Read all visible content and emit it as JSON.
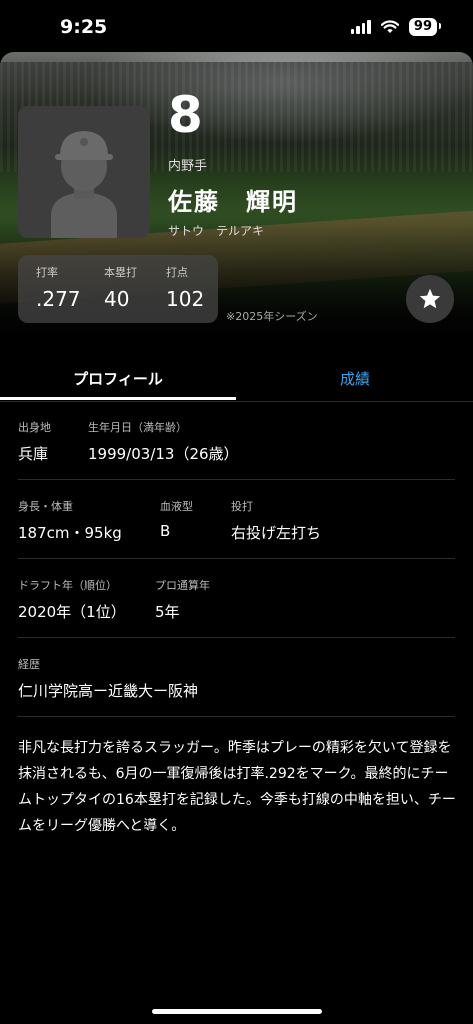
{
  "status_bar": {
    "time": "9:25",
    "battery": "99"
  },
  "player": {
    "number": "8",
    "position": "内野手",
    "name": "佐藤　輝明",
    "kana": "サトウ　テルアキ"
  },
  "stats": [
    {
      "label": "打率",
      "value": ".277"
    },
    {
      "label": "本塁打",
      "value": "40"
    },
    {
      "label": "打点",
      "value": "102"
    }
  ],
  "season_note": "※2025年シーズン",
  "tabs": {
    "profile": "プロフィール",
    "results": "成績"
  },
  "profile": {
    "birthplace": {
      "label": "出身地",
      "value": "兵庫"
    },
    "birthdate": {
      "label": "生年月日（満年齢）",
      "value": "1999/03/13（26歳）"
    },
    "height_weight": {
      "label": "身長・体重",
      "value": "187cm・95kg"
    },
    "blood_type": {
      "label": "血液型",
      "value": "B"
    },
    "throw_bat": {
      "label": "投打",
      "value": "右投げ左打ち"
    },
    "draft": {
      "label": "ドラフト年（順位）",
      "value": "2020年（1位）"
    },
    "pro_years": {
      "label": "プロ通算年",
      "value": "5年"
    },
    "career": {
      "label": "経歴",
      "value": "仁川学院高ー近畿大ー阪神"
    }
  },
  "bio": "非凡な長打力を誇るスラッガー。昨季はプレーの精彩を欠いて登録を抹消されるも、6月の一軍復帰後は打率.292をマーク。最終的にチームトップタイの16本塁打を記録した。今季も打線の中軸を担い、チームをリーグ優勝へと導く。",
  "colors": {
    "accent": "#3ea1ea",
    "background": "#000000",
    "card": "#464646"
  },
  "icons": {
    "favorite": "star-icon",
    "avatar": "person-placeholder-icon"
  }
}
